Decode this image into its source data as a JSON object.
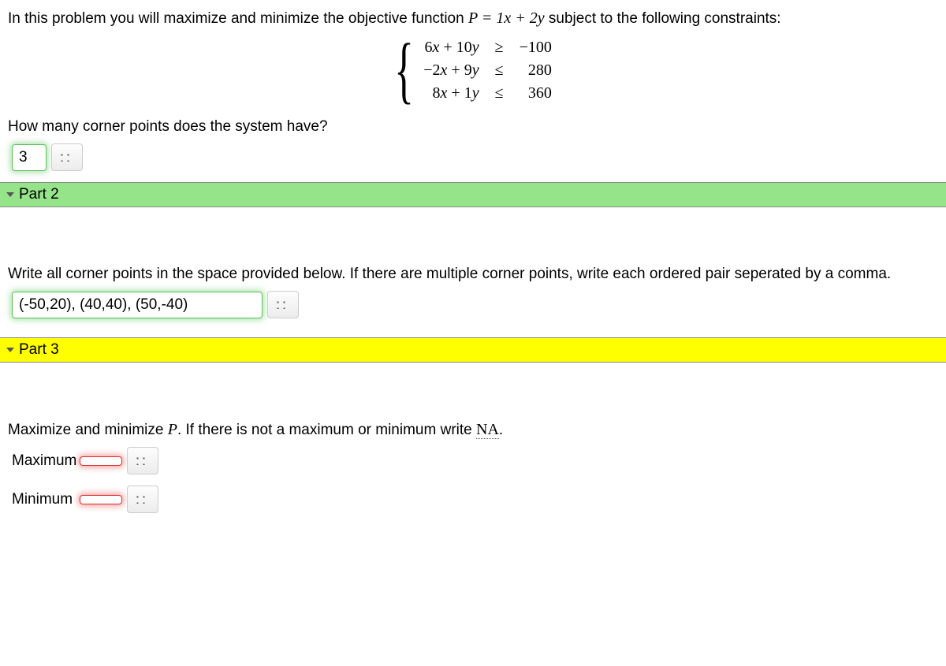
{
  "intro": {
    "pre": "In this problem you will maximize and minimize the objective function ",
    "obj": "P = 1x + 2y",
    "post": "  subject to the following constraints:"
  },
  "constraints": [
    {
      "lhs": "6x + 10y",
      "op": "≥",
      "rhs": "−100"
    },
    {
      "lhs": "−2x + 9y",
      "op": "≤",
      "rhs": "280"
    },
    {
      "lhs": "8x + 1y",
      "op": "≤",
      "rhs": "360"
    }
  ],
  "part1": {
    "question": "How many corner points does the system have?",
    "value": "3"
  },
  "part2": {
    "header": "Part 2",
    "question": "Write all corner points in the space provided below. If there are multiple corner points, write each ordered pair seperated by a comma.",
    "value": "(-50,20), (40,40), (50,-40)"
  },
  "part3": {
    "header": "Part 3",
    "prompt_pre": "Maximize and minimize ",
    "prompt_var": "P",
    "prompt_mid": ". If there is not a maximum or minimum write ",
    "prompt_na": "NA",
    "prompt_post": ".",
    "max_label": "Maximum",
    "min_label": "Minimum",
    "max_value": "",
    "min_value": ""
  }
}
